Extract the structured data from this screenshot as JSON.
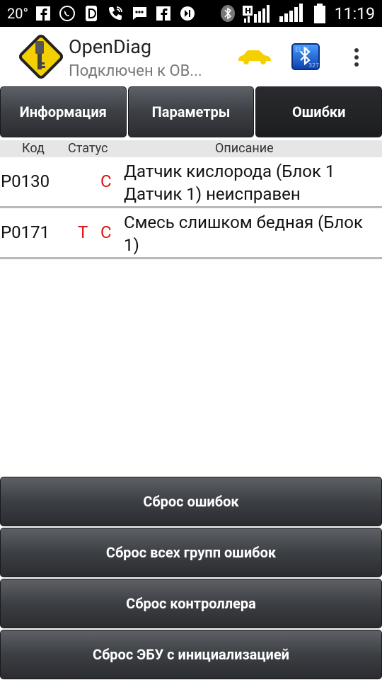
{
  "status_bar": {
    "temperature": "20°",
    "time": "11:19",
    "icons": [
      "facebook-icon",
      "viber-icon",
      "d-app-icon",
      "call-icon",
      "sms-icon",
      "facebook-icon",
      "media-icon",
      "bluetooth-icon",
      "signal-h-icon",
      "signal-icon",
      "battery-icon"
    ]
  },
  "app_bar": {
    "title": "OpenDiag",
    "subtitle": "Подключен к OB...",
    "car_icon_color": "#f5d000",
    "bluetooth_icon": "bluetooth-icon"
  },
  "tabs": [
    {
      "label": "Информация",
      "active": false
    },
    {
      "label": "Параметры",
      "active": false
    },
    {
      "label": "Ошибки",
      "active": true
    }
  ],
  "table": {
    "headers": {
      "code": "Код",
      "status": "Статус",
      "description": "Описание"
    },
    "rows": [
      {
        "code": "P0130",
        "status1": "",
        "status2": "C",
        "description": "Датчик кислорода (Блок 1 Датчик 1) неисправен"
      },
      {
        "code": "P0171",
        "status1": "T",
        "status2": "C",
        "description": "Смесь слишком бедная (Блок 1)"
      }
    ]
  },
  "buttons": {
    "reset_errors": "Сброс ошибок",
    "reset_all_groups": "Сброс всех групп ошибок",
    "reset_controller": "Сброс контроллера",
    "reset_ecu_init": "Сброс ЭБУ с инициализацией"
  },
  "colors": {
    "error_status": "#e01010",
    "tab_active": "#1c1d1f",
    "logo": "#f5d000"
  }
}
